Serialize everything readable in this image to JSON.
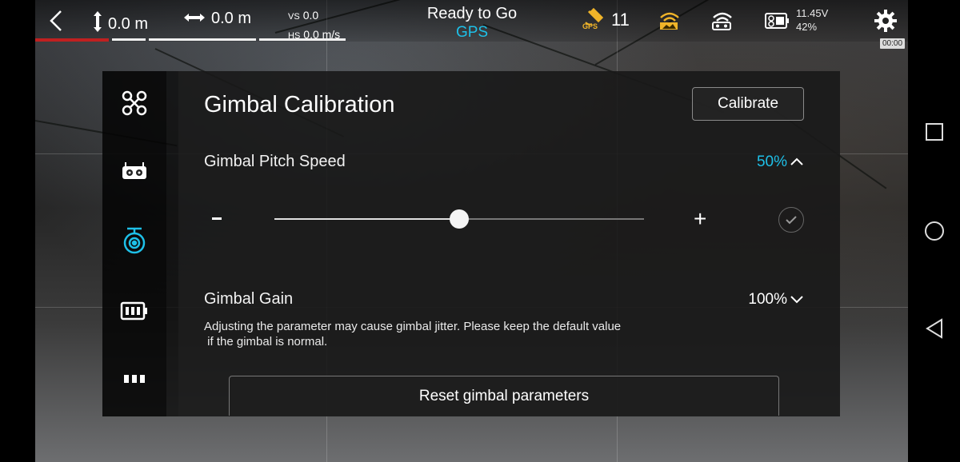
{
  "topbar": {
    "altitude": "0.0 m",
    "distance": "0.0 m",
    "vs_label": "VS",
    "vs_value": "0.0",
    "hs_label": "HS",
    "hs_value": "0.0 m/s",
    "status_main": "Ready to Go",
    "status_mode": "GPS",
    "gps_icon_text": "GPS",
    "satellites": "11",
    "battery_voltage": "11.45V",
    "battery_percent": "42%",
    "timer": "00:00"
  },
  "panel": {
    "title": "Gimbal Calibration",
    "calibrate_label": "Calibrate",
    "pitch_speed": {
      "label": "Gimbal Pitch Speed",
      "value": "50%",
      "level": 0.5,
      "minus": "-",
      "plus": "+"
    },
    "gimbal_gain": {
      "label": "Gimbal Gain",
      "value": "100%"
    },
    "note_line1": "Adjusting the parameter may cause gimbal jitter. Please keep the default value",
    "note_line2": " if the gimbal is normal.",
    "reset_label": "Reset gimbal parameters"
  },
  "side_icons": [
    "aircraft-icon",
    "remote-controller-icon",
    "gimbal-icon",
    "battery-icon",
    "more-icon"
  ],
  "colors": {
    "accent": "#1ec0e8",
    "progress_red": "#c02020"
  }
}
